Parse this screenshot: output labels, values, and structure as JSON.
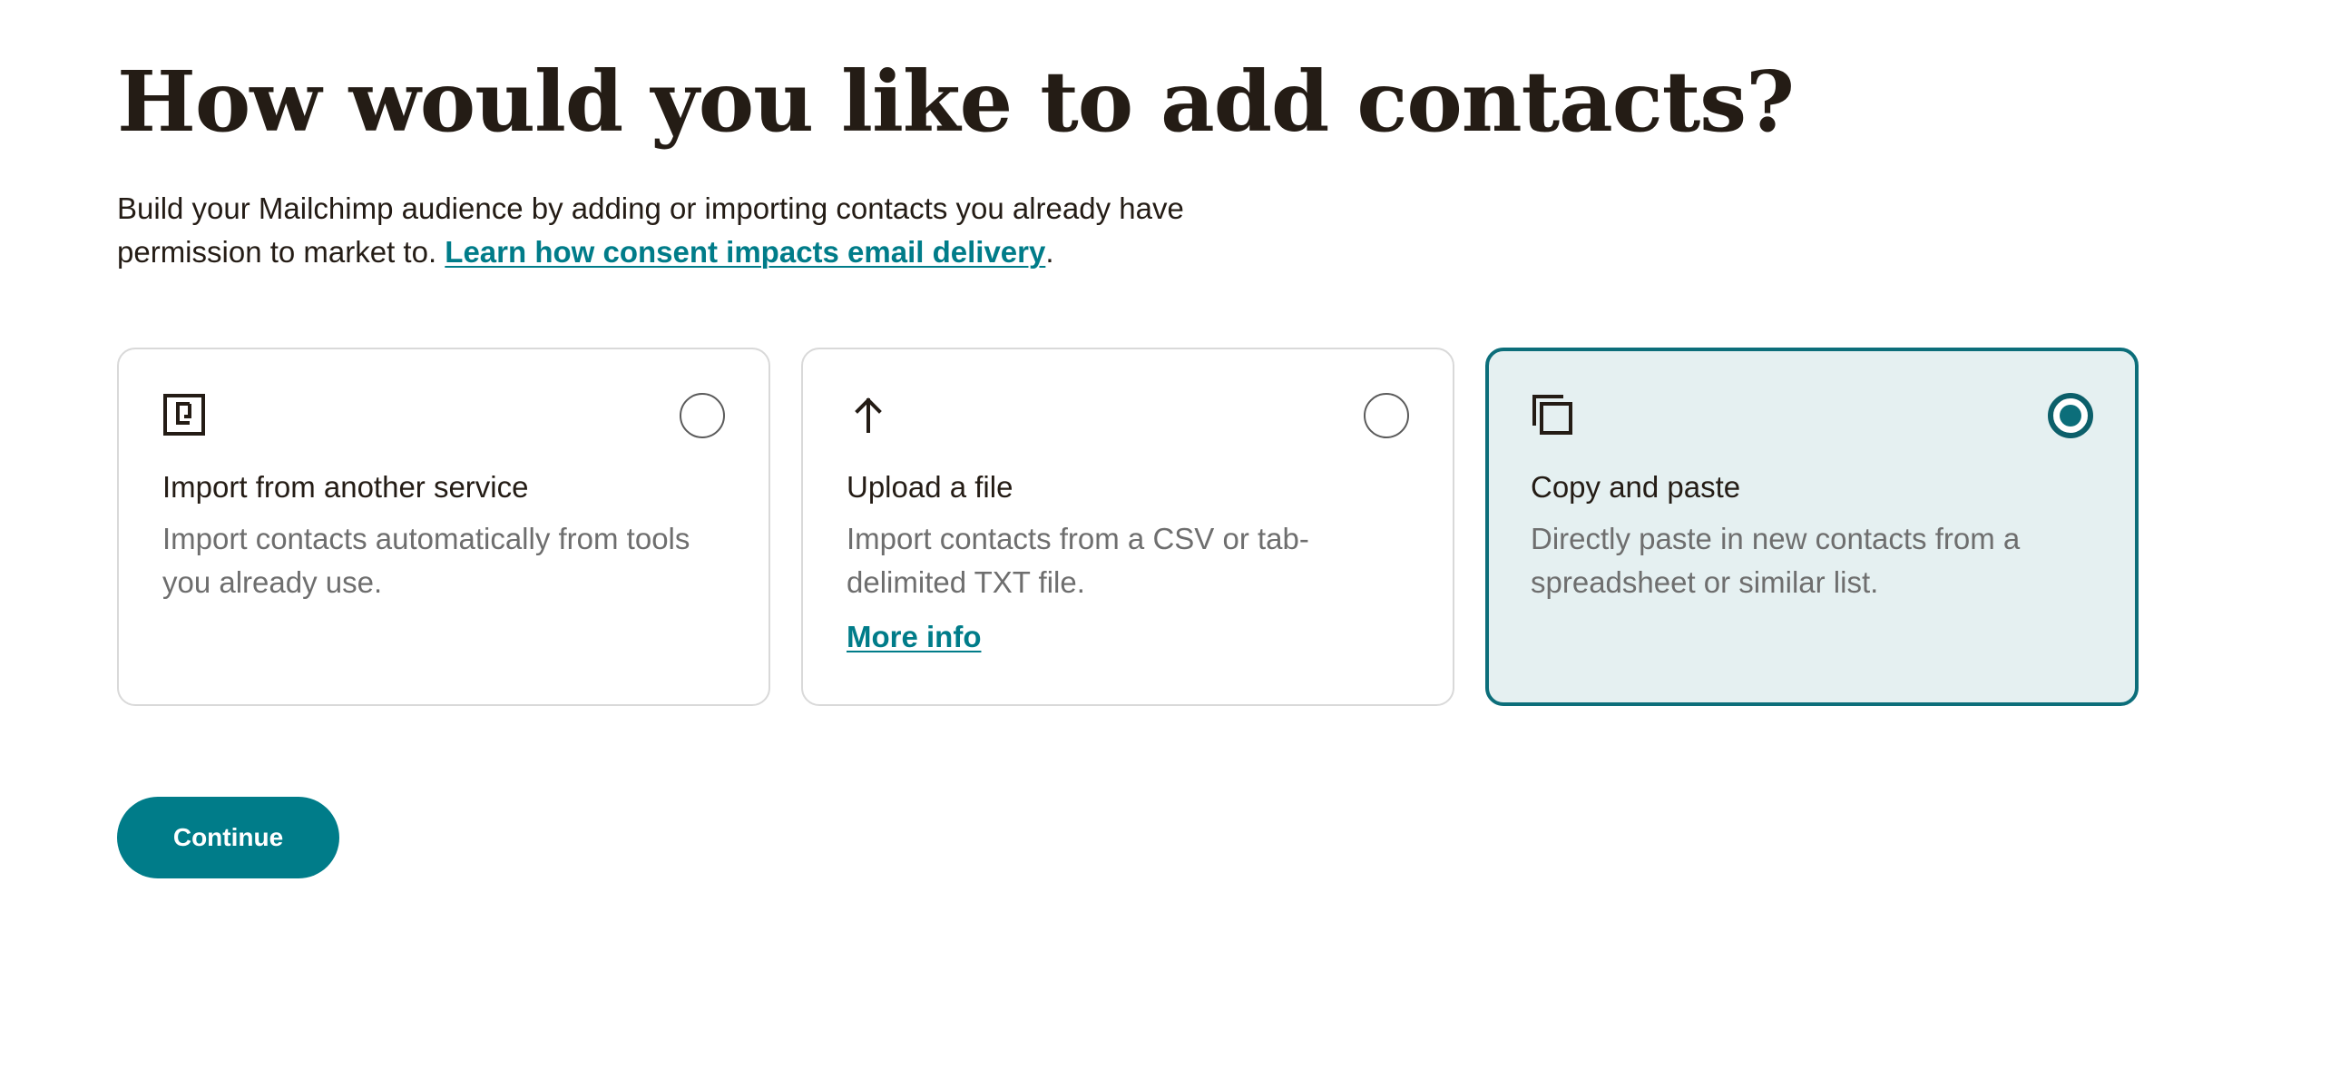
{
  "header": {
    "title": "How would you like to add contacts?"
  },
  "intro": {
    "text": "Build your Mailchimp audience by adding or importing contacts you already have permission to market to. ",
    "link_label": "Learn how consent impacts email delivery",
    "trailing": "."
  },
  "options": [
    {
      "icon": "import-service-icon",
      "title": "Import from another service",
      "description": "Import contacts automatically from tools you already use.",
      "selected": false
    },
    {
      "icon": "upload-arrow-icon",
      "title": "Upload a file",
      "description": "Import contacts from a CSV or tab-delimited TXT file.",
      "link_label": "More info",
      "selected": false
    },
    {
      "icon": "copy-icon",
      "title": "Copy and paste",
      "description": "Directly paste in new contacts from a spreadsheet or similar list.",
      "selected": true
    }
  ],
  "actions": {
    "continue_label": "Continue"
  },
  "colors": {
    "accent": "#007c89",
    "selected_border": "#0c6e7a",
    "selected_background": "#e5f0f1",
    "heading_text": "#241c15",
    "muted_text": "#6e6e6e"
  }
}
